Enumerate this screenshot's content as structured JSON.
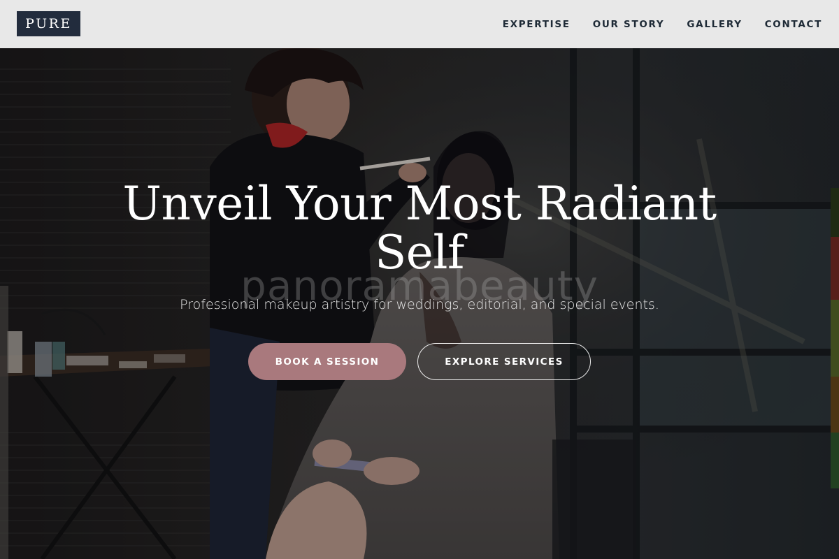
{
  "brand": {
    "logo_text": "PURE"
  },
  "nav": {
    "items": [
      {
        "label": "EXPERTISE"
      },
      {
        "label": "OUR STORY"
      },
      {
        "label": "GALLERY"
      },
      {
        "label": "CONTACT"
      }
    ]
  },
  "hero": {
    "title_line1": "Unveil Your Most Radiant",
    "title_line2": "Self",
    "subtitle": "Professional makeup artistry for weddings, editorial, and special events.",
    "watermark": "panoramabeauty",
    "primary_button": "BOOK A SESSION",
    "secondary_button": "EXPLORE SERVICES",
    "background_image": "makeup-artist-applying-makeup-photo"
  },
  "colors": {
    "nav_bg": "#e8e8e8",
    "logo_bg": "#222c3d",
    "nav_text": "#1e2a36",
    "primary_button": "#a9797d",
    "hero_text": "#ffffff"
  }
}
